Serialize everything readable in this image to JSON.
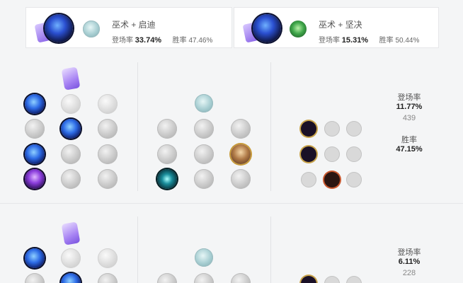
{
  "combos": [
    {
      "title": "巫术 + 启迪",
      "pick_label": "登场率",
      "pick_value": "33.74%",
      "win_label": "胜率",
      "win_value": "47.46%",
      "primary_icon": "sorcery-shard-icon",
      "keystone_icon": "arcane-comet-icon",
      "secondary_icon": "inspiration-icon"
    },
    {
      "title": "巫术 + 坚决",
      "pick_label": "登场率",
      "pick_value": "15.31%",
      "win_label": "胜率",
      "win_value": "50.44%",
      "primary_icon": "sorcery-shard-icon",
      "keystone_icon": "arcane-comet-icon",
      "secondary_icon": "resolve-icon"
    }
  ],
  "builds": [
    {
      "pick_label": "登场率",
      "pick_value": "11.77%",
      "count": "439",
      "win_label": "胜率",
      "win_value": "47.15%"
    },
    {
      "pick_label": "登场率",
      "pick_value": "6.11%",
      "count": "228"
    }
  ],
  "colors": {
    "background": "#f4f5f6",
    "card": "#ffffff",
    "text_strong": "#222222",
    "text_muted": "#888888"
  }
}
